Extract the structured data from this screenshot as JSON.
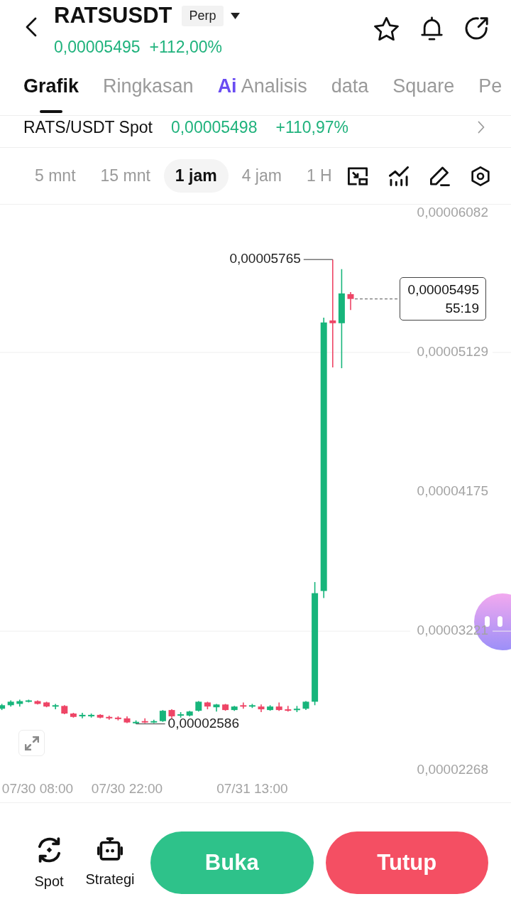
{
  "header": {
    "title": "RATSUSDT",
    "contract_badge": "Perp",
    "price": "0,00005495",
    "change": "+112,00%"
  },
  "tabs": [
    {
      "label": "Grafik",
      "selected": true
    },
    {
      "label": "Ringkasan",
      "selected": false
    },
    {
      "label": "Analisis",
      "prefix": "Ai",
      "selected": false
    },
    {
      "label": "data",
      "selected": false
    },
    {
      "label": "Square",
      "selected": false
    },
    {
      "label": "Pe",
      "selected": false
    }
  ],
  "spot_row": {
    "pair": "RATS/USDT Spot",
    "price": "0,00005498",
    "change": "+110,97%"
  },
  "timeframes": [
    {
      "label": "5 mnt",
      "selected": false
    },
    {
      "label": "15 mnt",
      "selected": false
    },
    {
      "label": "1 jam",
      "selected": true
    },
    {
      "label": "4 jam",
      "selected": false
    },
    {
      "label": "1 H",
      "selected": false
    }
  ],
  "chart": {
    "chart_data": {
      "type": "candlestick",
      "categories": [
        null,
        null,
        null,
        null,
        "07/30 08:00",
        null,
        null,
        null,
        null,
        null,
        null,
        null,
        null,
        null,
        "07/30 22:00",
        null,
        null,
        null,
        null,
        null,
        null,
        null,
        null,
        null,
        null,
        null,
        null,
        null,
        "07/31 13:00",
        null,
        null,
        null,
        null,
        null,
        null,
        null,
        null,
        null,
        null,
        null
      ],
      "ohlc": [
        [
          2.69e-05,
          2.723e-05,
          2.681e-05,
          2.714e-05
        ],
        [
          2.714e-05,
          2.747e-05,
          2.705e-05,
          2.738e-05
        ],
        [
          2.723e-05,
          2.752e-05,
          2.705e-05,
          2.742e-05
        ],
        [
          2.738e-05,
          2.752e-05,
          2.733e-05,
          2.747e-05
        ],
        [
          2.742e-05,
          2.747e-05,
          2.719e-05,
          2.723e-05
        ],
        [
          2.733e-05,
          2.738e-05,
          2.7e-05,
          2.705e-05
        ],
        [
          2.705e-05,
          2.723e-05,
          2.686e-05,
          2.714e-05
        ],
        [
          2.709e-05,
          2.714e-05,
          2.652e-05,
          2.657e-05
        ],
        [
          2.657e-05,
          2.662e-05,
          2.629e-05,
          2.634e-05
        ],
        [
          2.638e-05,
          2.662e-05,
          2.624e-05,
          2.648e-05
        ],
        [
          2.638e-05,
          2.657e-05,
          2.629e-05,
          2.648e-05
        ],
        [
          2.648e-05,
          2.652e-05,
          2.624e-05,
          2.629e-05
        ],
        [
          2.634e-05,
          2.643e-05,
          2.615e-05,
          2.624e-05
        ],
        [
          2.629e-05,
          2.638e-05,
          2.61e-05,
          2.619e-05
        ],
        [
          2.624e-05,
          2.638e-05,
          2.592e-05,
          2.596e-05
        ],
        [
          2.591e-05,
          2.61e-05,
          2.586e-05,
          2.6e-05
        ],
        [
          2.605e-05,
          2.624e-05,
          2.592e-05,
          2.596e-05
        ],
        [
          2.596e-05,
          2.615e-05,
          2.592e-05,
          2.605e-05
        ],
        [
          2.605e-05,
          2.681e-05,
          2.6e-05,
          2.676e-05
        ],
        [
          2.681e-05,
          2.686e-05,
          2.624e-05,
          2.638e-05
        ],
        [
          2.643e-05,
          2.667e-05,
          2.629e-05,
          2.652e-05
        ],
        [
          2.643e-05,
          2.676e-05,
          2.638e-05,
          2.671e-05
        ],
        [
          2.676e-05,
          2.742e-05,
          2.671e-05,
          2.738e-05
        ],
        [
          2.733e-05,
          2.738e-05,
          2.686e-05,
          2.705e-05
        ],
        [
          2.7e-05,
          2.723e-05,
          2.671e-05,
          2.719e-05
        ],
        [
          2.719e-05,
          2.723e-05,
          2.676e-05,
          2.681e-05
        ],
        [
          2.681e-05,
          2.709e-05,
          2.676e-05,
          2.705e-05
        ],
        [
          2.714e-05,
          2.733e-05,
          2.69e-05,
          2.705e-05
        ],
        [
          2.705e-05,
          2.723e-05,
          2.695e-05,
          2.714e-05
        ],
        [
          2.705e-05,
          2.719e-05,
          2.667e-05,
          2.686e-05
        ],
        [
          2.681e-05,
          2.714e-05,
          2.676e-05,
          2.705e-05
        ],
        [
          2.705e-05,
          2.733e-05,
          2.676e-05,
          2.681e-05
        ],
        [
          2.686e-05,
          2.709e-05,
          2.671e-05,
          2.676e-05
        ],
        [
          2.681e-05,
          2.709e-05,
          2.667e-05,
          2.69e-05
        ],
        [
          2.69e-05,
          2.742e-05,
          2.681e-05,
          2.738e-05
        ],
        [
          2.738e-05,
          3.557e-05,
          2.714e-05,
          3.481e-05
        ],
        [
          3.496e-05,
          5.367e-05,
          3.448e-05,
          5.334e-05
        ],
        [
          5.348e-05,
          5.765e-05,
          5.026e-05,
          5.329e-05
        ],
        [
          5.329e-05,
          5.699e-05,
          5.021e-05,
          5.533e-05
        ],
        [
          5.528e-05,
          5.542e-05,
          5.419e-05,
          5.495e-05
        ]
      ],
      "ylim": [
        2.268e-05,
        6.082e-05
      ],
      "yticks": [
        {
          "value": 6.082e-05,
          "label": "0,00006082"
        },
        {
          "value": 5.129e-05,
          "label": "0,00005129"
        },
        {
          "value": 4.175e-05,
          "label": "0,00004175"
        },
        {
          "value": 3.221e-05,
          "label": "0,00003221"
        },
        {
          "value": 2.268e-05,
          "label": "0,00002268"
        }
      ],
      "annotations": [
        "0,00005765",
        "0,00002586"
      ]
    },
    "price_tag": {
      "price": "0,00005495",
      "countdown": "55:19"
    }
  },
  "bottom_bar": {
    "shortcuts": [
      {
        "label": "Spot",
        "kind": "spot"
      },
      {
        "label": "Strategi",
        "kind": "strategy"
      }
    ],
    "buttons": [
      {
        "label": "Buka",
        "kind": "open"
      },
      {
        "label": "Tutup",
        "kind": "close"
      }
    ]
  }
}
